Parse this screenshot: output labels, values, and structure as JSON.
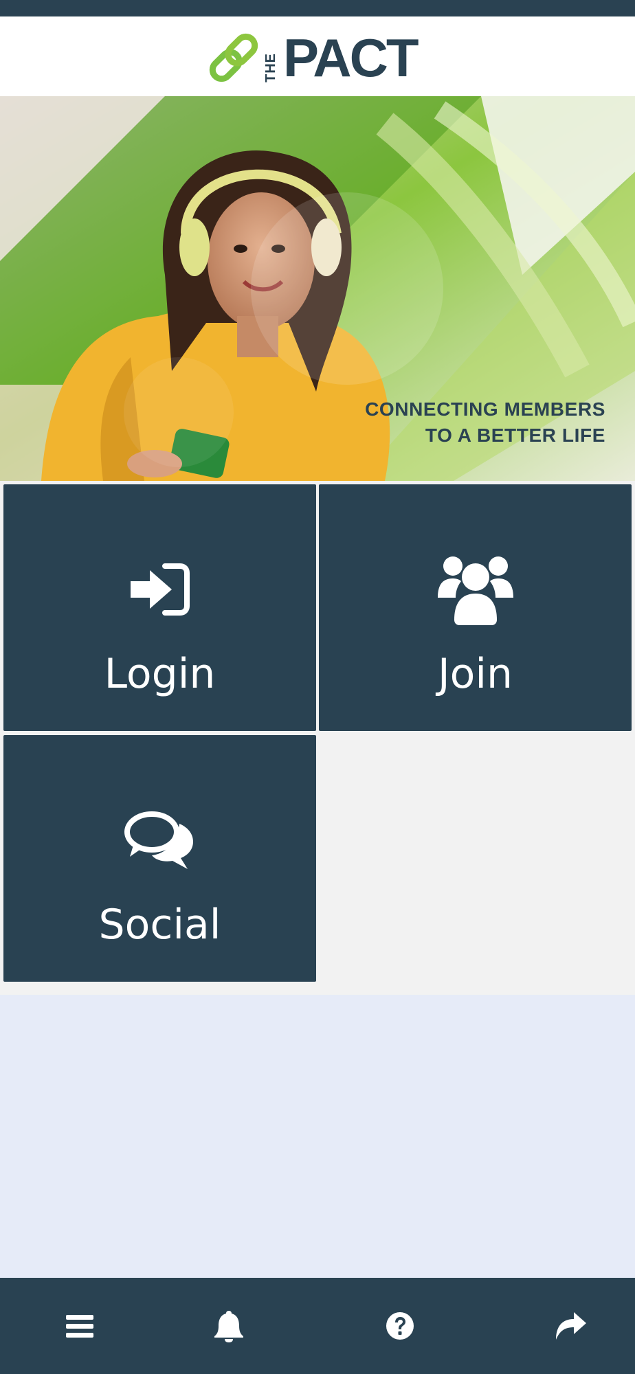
{
  "app": {
    "logo_text_the": "THE",
    "logo_text_pact": "PACT"
  },
  "hero": {
    "tagline_line1": "CONNECTING MEMBERS",
    "tagline_line2": "TO A BETTER LIFE"
  },
  "tiles": [
    {
      "label": "Login",
      "icon": "sign-in-icon"
    },
    {
      "label": "Join",
      "icon": "users-icon"
    },
    {
      "label": "Social",
      "icon": "comments-icon"
    }
  ],
  "bottom_nav": [
    {
      "icon": "menu-icon"
    },
    {
      "icon": "bell-icon"
    },
    {
      "icon": "help-icon"
    },
    {
      "icon": "share-icon"
    }
  ],
  "colors": {
    "brand_dark": "#294252",
    "brand_green": "#7cc242",
    "content_bg": "#e6ebf8",
    "tiles_bg": "#f2f2f2"
  }
}
